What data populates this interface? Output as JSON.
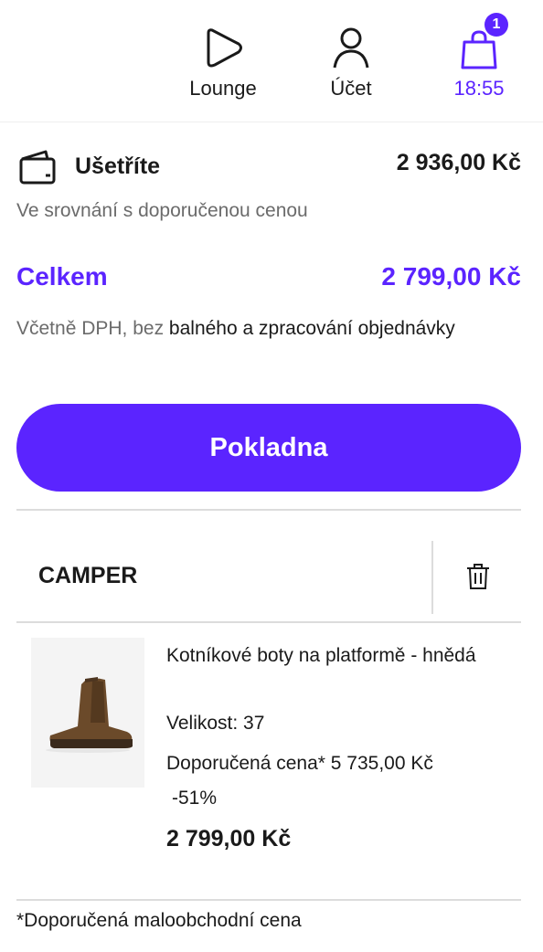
{
  "nav": {
    "items": [
      {
        "label": "Lounge",
        "icon": "play-icon"
      },
      {
        "label": "Účet",
        "icon": "user-icon"
      },
      {
        "label": "18:55",
        "icon": "shopping-bag-icon",
        "badge": "1"
      }
    ]
  },
  "summary": {
    "savings_label": "Ušetříte",
    "savings_amount": "2 936,00 Kč",
    "savings_note": "Ve srovnání s doporučenou cenou",
    "total_label": "Celkem",
    "total_amount": "2 799,00 Kč",
    "vat_note_prefix": "Včetně DPH, bez ",
    "vat_note_link": "balného a zpracování objednávky"
  },
  "checkout": {
    "label": "Pokladna"
  },
  "cart": {
    "brand": "CAMPER",
    "item": {
      "name": "Kotníkové boty na platformě - hnědá",
      "size": "Velikost: 37",
      "rrp": "Doporučená cena* 5 735,00 Kč",
      "discount": "-51%",
      "price": "2 799,00 Kč"
    }
  },
  "footnote": "*Doporučená maloobchodní cena",
  "colors": {
    "accent": "#5b24ff",
    "muted": "#6b6b6b"
  }
}
